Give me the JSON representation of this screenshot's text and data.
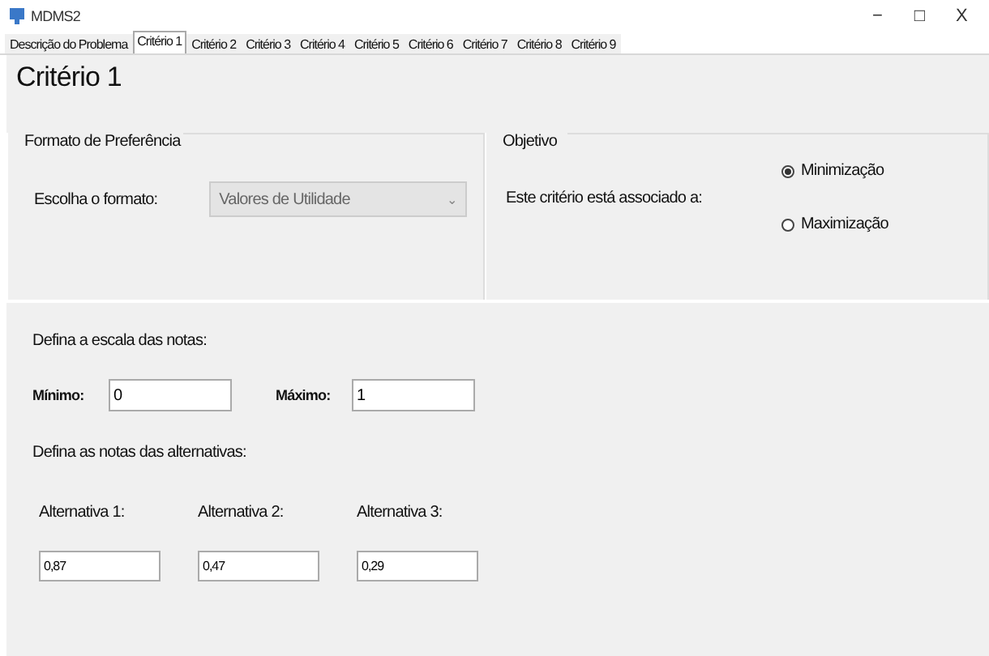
{
  "window": {
    "title": "MDMS2",
    "controls": [
      "−",
      "□",
      "X"
    ]
  },
  "tabs": [
    {
      "label": "Descrição do Problema",
      "selected": false
    },
    {
      "label": "Critério 1",
      "selected": true
    },
    {
      "label": "Critério 2",
      "selected": false
    },
    {
      "label": "Critério 3",
      "selected": false
    },
    {
      "label": "Critério 4",
      "selected": false
    },
    {
      "label": "Critério 5",
      "selected": false
    },
    {
      "label": "Critério 6",
      "selected": false
    },
    {
      "label": "Critério 7",
      "selected": false
    },
    {
      "label": "Critério 8",
      "selected": false
    },
    {
      "label": "Critério 9",
      "selected": false
    }
  ],
  "heading": "Critério 1",
  "preference_group": {
    "title": "Formato de Preferência",
    "label": "Escolha o formato:",
    "dropdown": {
      "value": "Valores de Utilidade",
      "caret": "⌄",
      "disabled": true
    }
  },
  "objective_group": {
    "title": "Objetivo",
    "label": "Este critério está associado a:",
    "options": [
      {
        "label": "Minimização",
        "selected": true
      },
      {
        "label": "Maximização",
        "selected": false
      }
    ]
  },
  "scale": {
    "label": "Defina a escala das notas:",
    "fields": [
      {
        "label": "Mínimo:",
        "value": "0"
      },
      {
        "label": "Máximo:",
        "value": "1"
      }
    ]
  },
  "alternatives": {
    "label": "Defina as notas das alternativas:",
    "items": [
      {
        "label": "Alternativa 1:",
        "value": "0,87"
      },
      {
        "label": "Alternativa 2:",
        "value": "0,47"
      },
      {
        "label": "Alternativa 3:",
        "value": "0,29"
      }
    ]
  }
}
